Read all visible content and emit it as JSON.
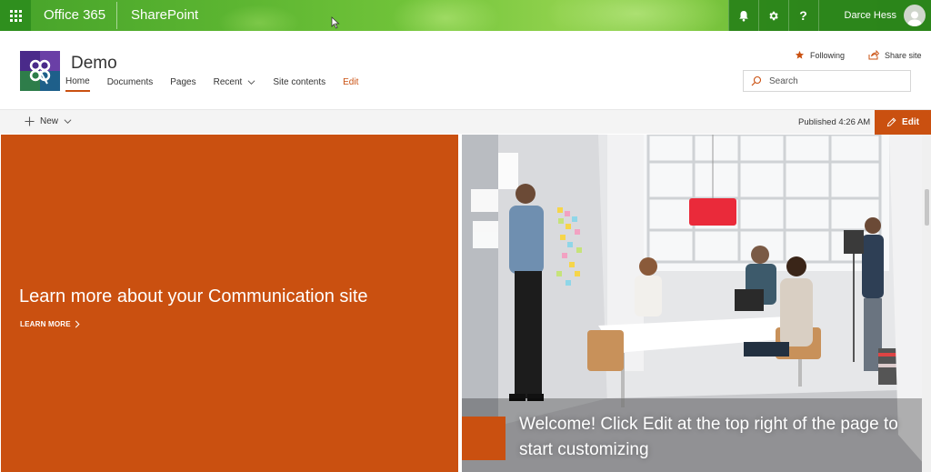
{
  "suitebar": {
    "brand": "Office 365",
    "app": "SharePoint",
    "user_name": "Darce Hess",
    "icons": [
      "waffle-icon",
      "bell-icon",
      "gear-icon",
      "help-icon"
    ],
    "help_label": "?",
    "accent": "#5cb531"
  },
  "site": {
    "title": "Demo",
    "nav": [
      {
        "label": "Home"
      },
      {
        "label": "Documents"
      },
      {
        "label": "Pages"
      },
      {
        "label": "Recent"
      },
      {
        "label": "Site contents"
      },
      {
        "label": "Edit"
      }
    ],
    "following_label": "Following",
    "share_label": "Share site",
    "search_placeholder": "Search",
    "accent": "#ca5010"
  },
  "commandbar": {
    "new_label": "New",
    "published": "Published 4:26 AM",
    "edit_label": "Edit"
  },
  "hero": {
    "left_title": "Learn more about your Communication site",
    "learn_more": "LEARN MORE",
    "right_title": "Welcome! Click Edit at the top right of the page to start customizing",
    "tile_color": "#ca5010"
  }
}
